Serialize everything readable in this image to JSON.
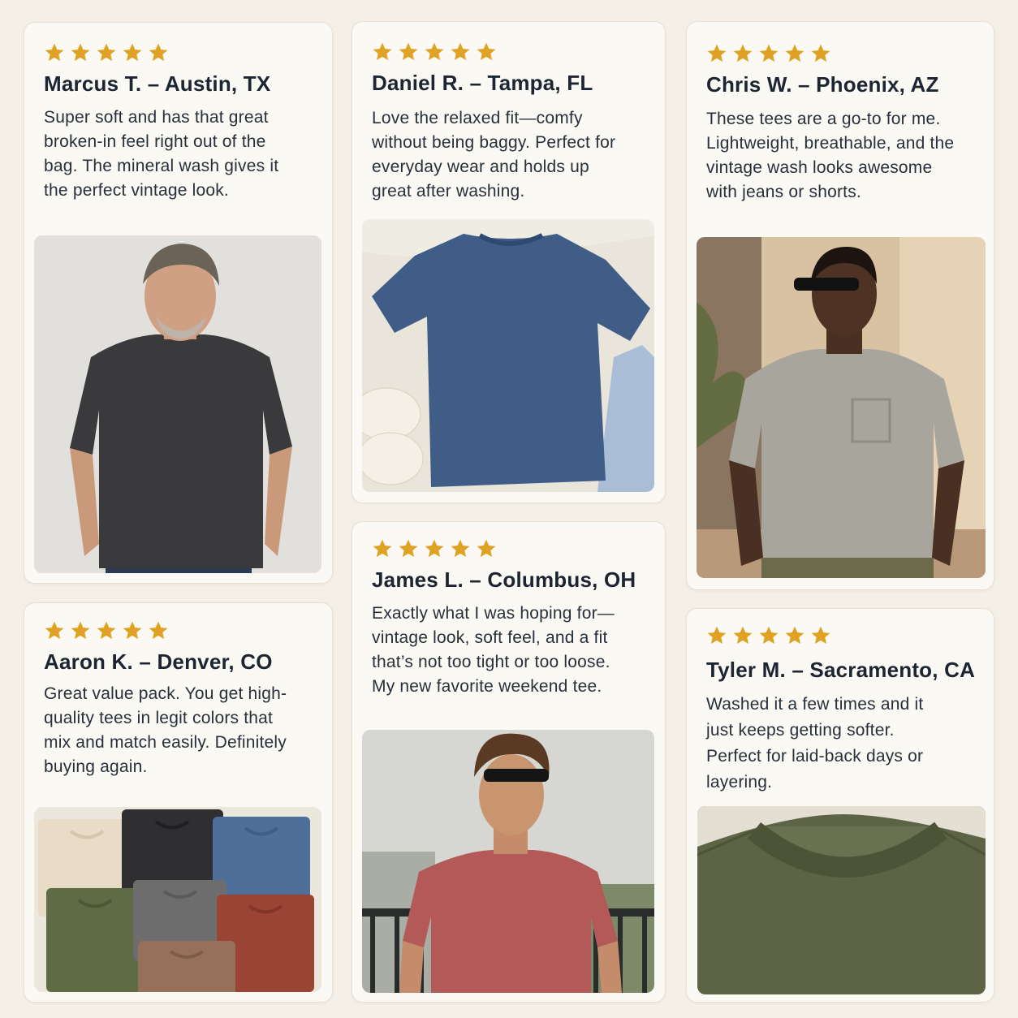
{
  "reviews": [
    {
      "rating": 5,
      "reviewer": "Marcus T. – Austin, TX",
      "text": "Super soft and has that great broken-in feel right out of the bag. The mineral wash gives it the perfect vintage look.",
      "photo": "man in charcoal tee",
      "shirt_color": "#3a3a3c"
    },
    {
      "rating": 5,
      "reviewer": "Daniel R. – Tampa, FL",
      "text": "Love the relaxed fit—comfy without being baggy. Perfect for everyday wear and holds up great after washing.",
      "photo": "blue tee flat lay",
      "shirt_color": "#3f5d86"
    },
    {
      "rating": 5,
      "reviewer": "Chris W. – Phoenix, AZ",
      "text": "These tees are a go-to for me. Lightweight, breathable, and the vintage wash looks awesome with jeans or shorts.",
      "photo": "man in gray pocket tee",
      "shirt_color": "#a8a59c"
    },
    {
      "rating": 5,
      "reviewer": "Aaron K. – Denver, CO",
      "text": "Great value pack. You get high-quality tees in legit colors that mix and match easily. Definitely buying again.",
      "photo": "folded tees stack",
      "colors": [
        "#e8dcc6",
        "#2f2f31",
        "#4d6f9a",
        "#5f6b45",
        "#6d6d6d",
        "#9a4436",
        "#96705a"
      ]
    },
    {
      "rating": 5,
      "reviewer": "James L. – Columbus, OH",
      "text": "Exactly what I was hoping for—vintage look, soft feel, and a fit that’s not too tight or too loose. My new favorite weekend tee.",
      "photo": "man in red tee outdoors",
      "shirt_color": "#b35a58"
    },
    {
      "rating": 5,
      "reviewer": "Tyler M. – Sacramento, CA",
      "text": "Washed it a few times and it just keeps getting softer. Perfect for laid-back days or layering.",
      "photo": "olive tee collar close-up",
      "shirt_color": "#5d6446"
    }
  ]
}
